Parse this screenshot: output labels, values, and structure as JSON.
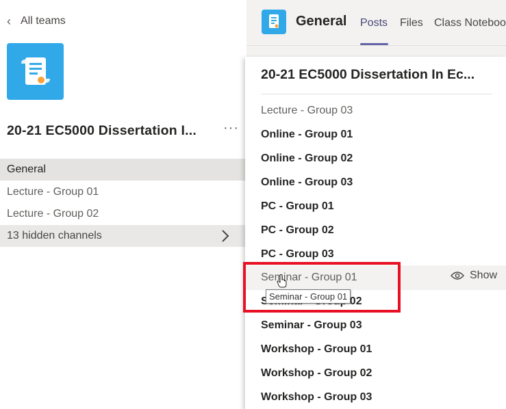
{
  "sidebar": {
    "back_label": "All teams",
    "team_name": "20-21 EC5000 Dissertation I...",
    "more_label": "···",
    "channels": [
      {
        "label": "General",
        "state": "active"
      },
      {
        "label": "Lecture - Group 01",
        "state": "normal"
      },
      {
        "label": "Lecture - Group 02",
        "state": "normal"
      }
    ],
    "hidden_channels_label": "13 hidden channels"
  },
  "header": {
    "channel_title": "General",
    "tabs": [
      "Posts",
      "Files",
      "Class Noteboo"
    ]
  },
  "panel": {
    "title": "20-21 EC5000 Dissertation In Ec...",
    "items": [
      {
        "label": "Lecture - Group 03",
        "style": "light"
      },
      {
        "label": "Online - Group 01",
        "style": "bold"
      },
      {
        "label": "Online - Group 02",
        "style": "bold"
      },
      {
        "label": "Online - Group 03",
        "style": "bold"
      },
      {
        "label": "PC - Group 01",
        "style": "bold"
      },
      {
        "label": "PC - Group 02",
        "style": "bold"
      },
      {
        "label": "PC - Group 03",
        "style": "bold"
      },
      {
        "label": "Seminar - Group 01",
        "style": "light"
      },
      {
        "label": "Seminar - Group 02",
        "style": "bold"
      },
      {
        "label": "Seminar - Group 03",
        "style": "bold"
      },
      {
        "label": "Workshop - Group 01",
        "style": "bold"
      },
      {
        "label": "Workshop - Group 02",
        "style": "bold"
      },
      {
        "label": "Workshop - Group 03",
        "style": "bold"
      }
    ],
    "show_label": "Show",
    "tooltip": "Seminar - Group 01"
  },
  "colors": {
    "team_tile": "#31a9e8",
    "accent": "#6264a7",
    "highlight_box": "#e81123"
  },
  "icons": {
    "back": "chevron-left-icon",
    "team": "scroll-document-icon",
    "expand": "chevron-right-icon",
    "show": "eye-icon",
    "cursor": "hand-pointer-icon"
  }
}
